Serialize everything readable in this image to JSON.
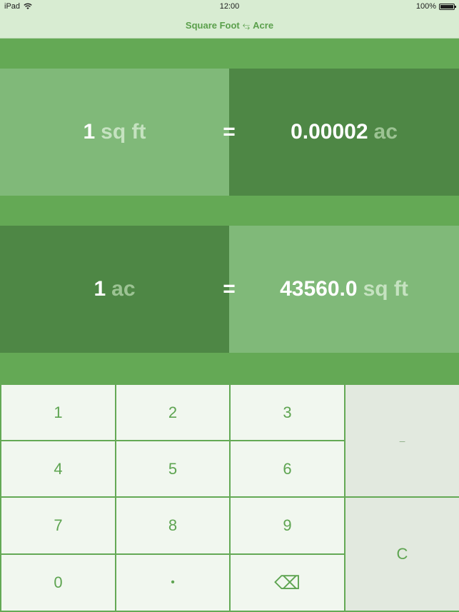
{
  "status_bar": {
    "device": "iPad",
    "time": "12:00",
    "battery": "100%"
  },
  "nav": {
    "from_unit": "Square Foot",
    "swap_glyph": "⥃",
    "to_unit": "Acre"
  },
  "conversions": [
    {
      "input_value": "1",
      "input_unit": "sq ft",
      "equals": "=",
      "output_value": "0.00002",
      "output_unit": "ac"
    },
    {
      "input_value": "1",
      "input_unit": "ac",
      "equals": "=",
      "output_value": "43560.0",
      "output_unit": "sq ft"
    }
  ],
  "keypad": {
    "k1": "1",
    "k2": "2",
    "k3": "3",
    "k4": "4",
    "k5": "5",
    "k6": "6",
    "k7": "7",
    "k8": "8",
    "k9": "9",
    "k0": "0",
    "dot": "•",
    "backspace": "⌫",
    "minus": "–",
    "clear": "C"
  },
  "colors": {
    "accent": "#64a955",
    "light_panel": "#80b979",
    "dark_panel": "#4e8745",
    "key_bg": "#f1f7ef",
    "key_text": "#5ea451"
  }
}
